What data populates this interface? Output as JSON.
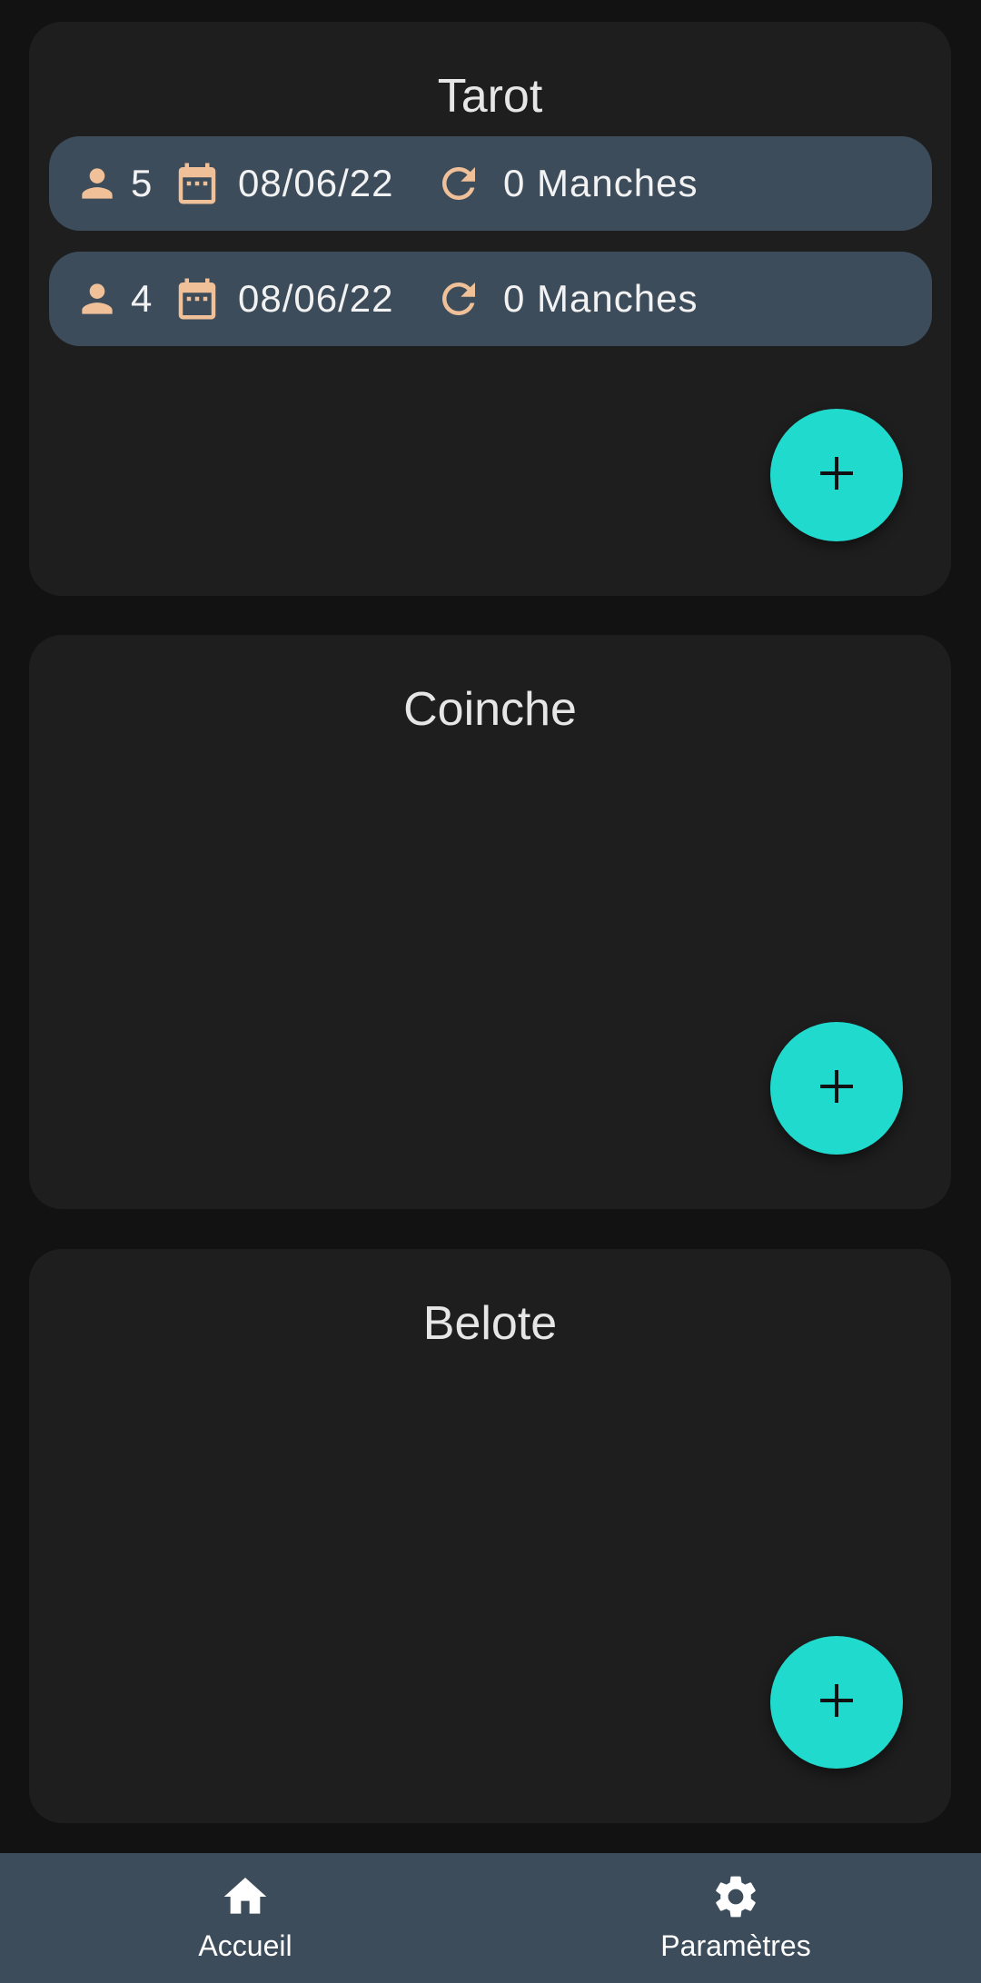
{
  "colors": {
    "background": "#121212",
    "card": "#1e1e1e",
    "row": "#3d4c5b",
    "accent_icon": "#f0c098",
    "fab": "#20dacd",
    "nav": "#3d4c5b"
  },
  "sections": [
    {
      "title": "Tarot",
      "games": [
        {
          "players": "5",
          "date": "08/06/22",
          "rounds": "0 Manches"
        },
        {
          "players": "4",
          "date": "08/06/22",
          "rounds": "0 Manches"
        }
      ]
    },
    {
      "title": "Coinche",
      "games": []
    },
    {
      "title": "Belote",
      "games": []
    }
  ],
  "icons": {
    "players": "person-icon",
    "date": "calendar-icon",
    "rounds": "refresh-icon",
    "add": "plus-icon",
    "home": "home-icon",
    "settings": "gear-icon"
  },
  "nav": {
    "home_label": "Accueil",
    "settings_label": "Paramètres"
  }
}
